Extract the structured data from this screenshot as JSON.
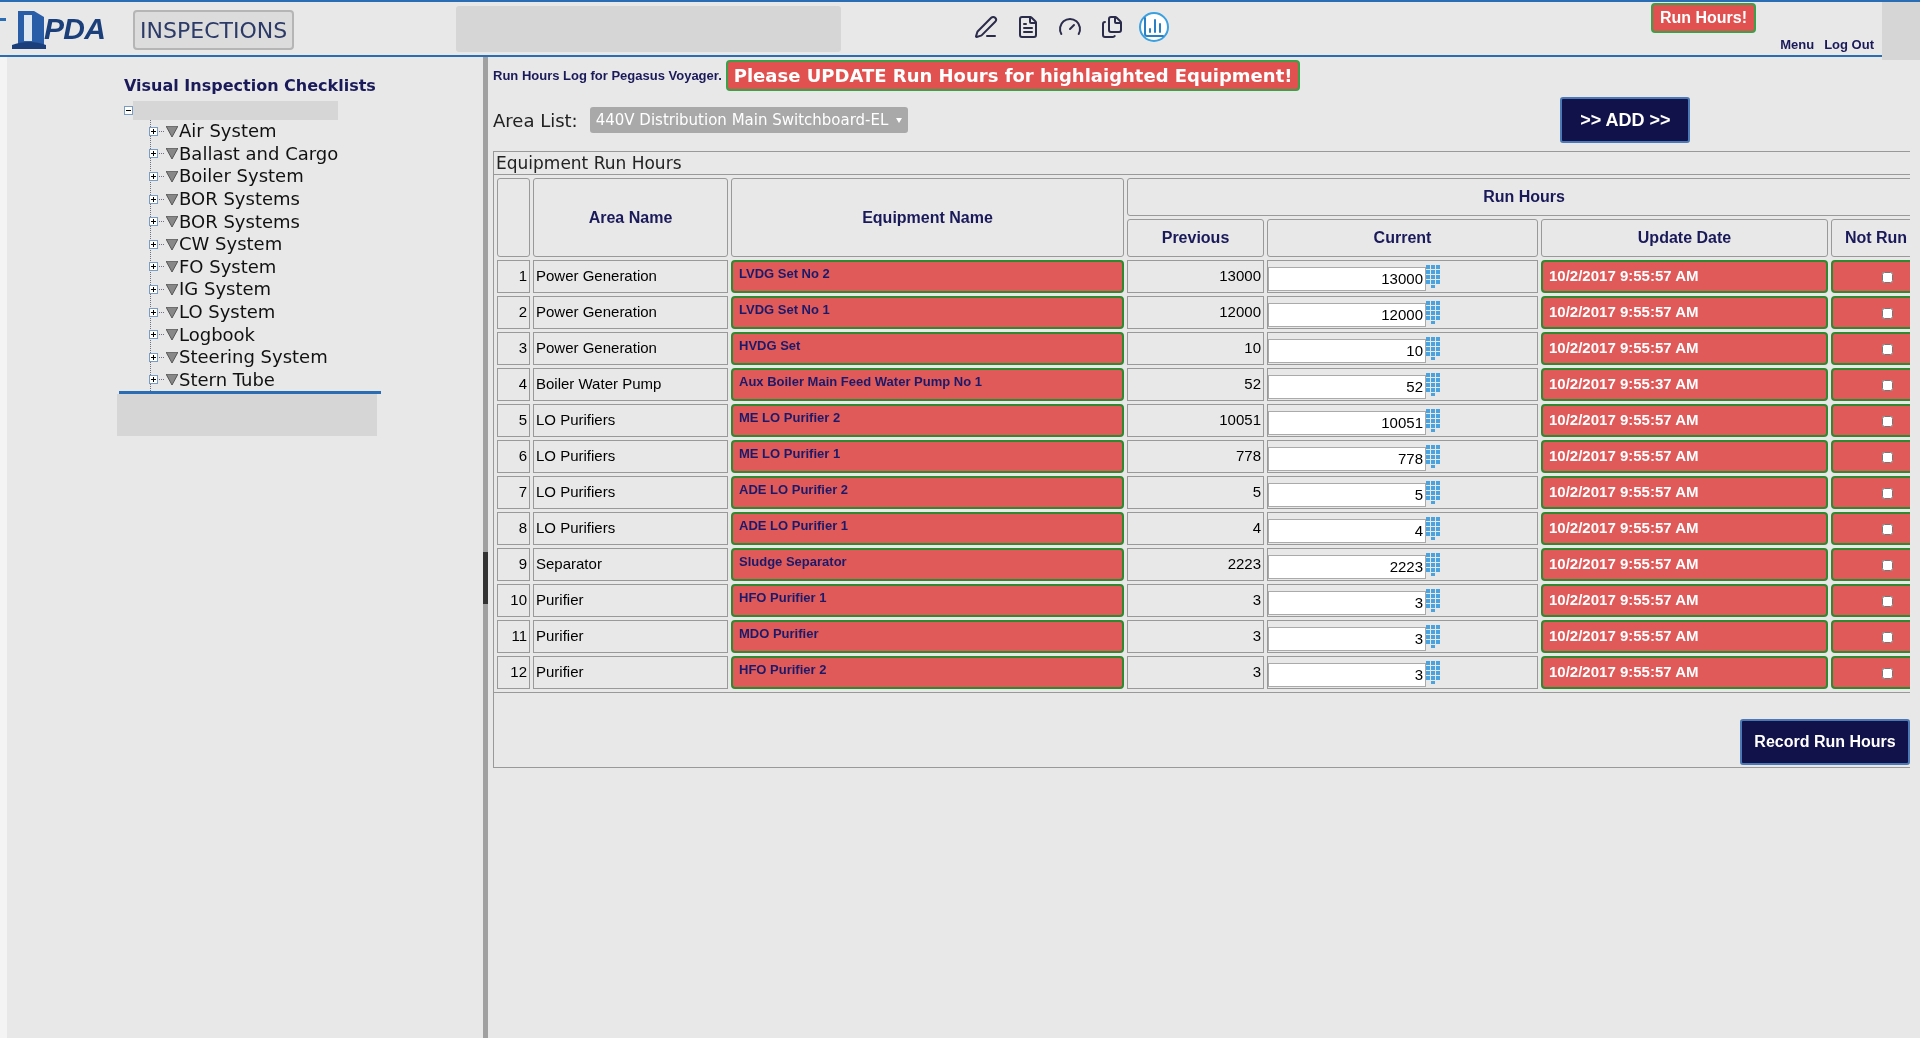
{
  "header": {
    "logo": "PDA",
    "module_button": "INSPECTIONS",
    "toolbar_icons": [
      {
        "kind": "edit",
        "selected": false
      },
      {
        "kind": "alert-doc",
        "selected": false
      },
      {
        "kind": "check",
        "selected": false
      },
      {
        "kind": "docs",
        "selected": false
      },
      {
        "kind": "chart",
        "selected": true
      }
    ],
    "badge": "Run Hours!",
    "links": [
      "Menu",
      "Log Out"
    ]
  },
  "sidebar": {
    "title": "Visual Inspection Checklists",
    "tree": {
      "expanded": true,
      "children": [
        {
          "label": "Air System",
          "expanded": false
        },
        {
          "label": "Ballast and Cargo",
          "expanded": false
        },
        {
          "label": "Boiler System",
          "expanded": false
        },
        {
          "label": "BOR Systems",
          "expanded": false
        },
        {
          "label": "BOR Systems",
          "expanded": false
        },
        {
          "label": "CW System",
          "expanded": false
        },
        {
          "label": "FO System",
          "expanded": false
        },
        {
          "label": "IG System",
          "expanded": false
        },
        {
          "label": "LO System",
          "expanded": false
        },
        {
          "label": "Logbook",
          "expanded": false
        },
        {
          "label": "Steering System",
          "expanded": false
        },
        {
          "label": "Stern Tube",
          "expanded": false
        }
      ]
    }
  },
  "main": {
    "log_title": "Run Hours Log for Pegasus Voyager.",
    "warning": "Please UPDATE Run Hours for highlaighted Equipment!",
    "area_label": "Area List:",
    "area_value": "440V Distribution Main Switchboard-EL",
    "add_button": ">> ADD >>",
    "table": {
      "caption": "Equipment Run Hours",
      "columns": [
        "Area Name",
        "Equipment Name",
        "Run Hours",
        "Previous",
        "Current",
        "Update Date",
        "Not Run"
      ],
      "rows": [
        {
          "index": "1",
          "area": "Power Generation",
          "equipment": "LVDG Set No 2",
          "previous": "13000",
          "current": "13000",
          "update_date": "10/2/2017 9:55:57 AM",
          "highlighted": true,
          "not_run": false
        },
        {
          "index": "2",
          "area": "Power Generation",
          "equipment": "LVDG Set No 1",
          "previous": "12000",
          "current": "12000",
          "update_date": "10/2/2017 9:55:57 AM",
          "highlighted": true,
          "not_run": false
        },
        {
          "index": "3",
          "area": "Power Generation",
          "equipment": "HVDG Set",
          "previous": "10",
          "current": "10",
          "update_date": "10/2/2017 9:55:57 AM",
          "highlighted": true,
          "not_run": false
        },
        {
          "index": "4",
          "area": "Boiler Water Pump",
          "equipment": "Aux Boiler Main Feed Water Pump No 1",
          "previous": "52",
          "current": "52",
          "update_date": "10/2/2017 9:55:37 AM",
          "highlighted": true,
          "not_run": false
        },
        {
          "index": "5",
          "area": "LO Purifiers",
          "equipment": "ME LO Purifier 2",
          "previous": "10051",
          "current": "10051",
          "update_date": "10/2/2017 9:55:57 AM",
          "highlighted": true,
          "not_run": false
        },
        {
          "index": "6",
          "area": "LO Purifiers",
          "equipment": "ME LO Purifier 1",
          "previous": "778",
          "current": "778",
          "update_date": "10/2/2017 9:55:57 AM",
          "highlighted": true,
          "not_run": false
        },
        {
          "index": "7",
          "area": "LO Purifiers",
          "equipment": "ADE LO Purifier 2",
          "previous": "5",
          "current": "5",
          "update_date": "10/2/2017 9:55:57 AM",
          "highlighted": true,
          "not_run": false
        },
        {
          "index": "8",
          "area": "LO Purifiers",
          "equipment": "ADE LO Purifier 1",
          "previous": "4",
          "current": "4",
          "update_date": "10/2/2017 9:55:57 AM",
          "highlighted": true,
          "not_run": false
        },
        {
          "index": "9",
          "area": "Separator",
          "equipment": "Sludge Separator",
          "previous": "2223",
          "current": "2223",
          "update_date": "10/2/2017 9:55:57 AM",
          "highlighted": true,
          "not_run": false
        },
        {
          "index": "10",
          "area": "Purifier",
          "equipment": "HFO Purifier 1",
          "previous": "3",
          "current": "3",
          "update_date": "10/2/2017 9:55:57 AM",
          "highlighted": true,
          "not_run": false
        },
        {
          "index": "11",
          "area": "Purifier",
          "equipment": "MDO Purifier",
          "previous": "3",
          "current": "3",
          "update_date": "10/2/2017 9:55:57 AM",
          "highlighted": true,
          "not_run": false
        },
        {
          "index": "12",
          "area": "Purifier",
          "equipment": "HFO Purifier 2",
          "previous": "3",
          "current": "3",
          "update_date": "10/2/2017 9:55:57 AM",
          "highlighted": true,
          "not_run": false
        }
      ]
    },
    "record_button": "Record Run Hours"
  }
}
